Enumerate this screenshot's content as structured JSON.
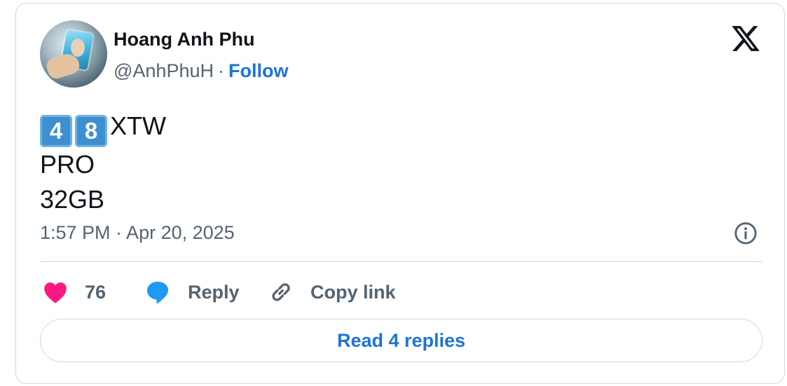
{
  "author": {
    "name": "Hoang Anh Phu",
    "handle": "@AnhPhuH",
    "separator": "·",
    "follow_label": "Follow"
  },
  "brand": {
    "logo_icon": "x-logo-icon"
  },
  "tweet": {
    "keycaps": [
      "4",
      "8"
    ],
    "line1_suffix": "XTW",
    "line2": "PRO",
    "line3": "32GB",
    "timestamp": "1:57 PM · Apr 20, 2025"
  },
  "actions": {
    "like_count": "76",
    "reply_label": "Reply",
    "copy_label": "Copy link"
  },
  "footer": {
    "read_replies_label": "Read 4 replies"
  },
  "colors": {
    "accent": "#1d74d6",
    "like": "#f91880",
    "reply_icon": "#1d9bf0",
    "muted": "#536471",
    "border": "#cfd9de"
  }
}
